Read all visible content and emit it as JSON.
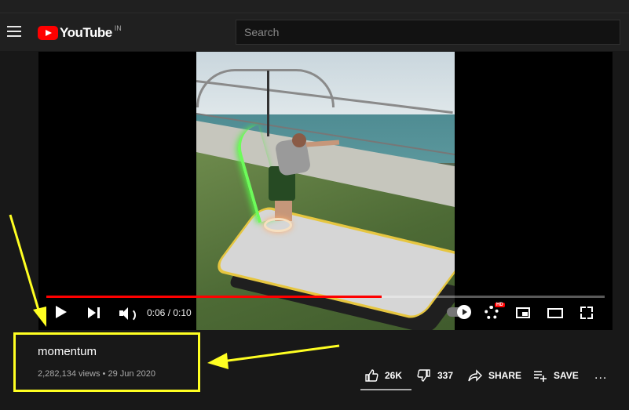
{
  "masthead": {
    "logo_text": "YouTube",
    "country_code": "IN",
    "search_placeholder": "Search"
  },
  "player": {
    "time_display": "0:06 / 0:10",
    "progress_fraction": 0.6,
    "hd_badge": "HD"
  },
  "video": {
    "title": "momentum",
    "views_date": "2,282,134 views • 29 Jun 2020"
  },
  "actions": {
    "like_count": "26K",
    "dislike_count": "337",
    "share_label": "SHARE",
    "save_label": "SAVE",
    "more_label": "..."
  },
  "colors": {
    "accent": "#ff0000",
    "annotation": "#ffff22",
    "background": "#181818"
  }
}
